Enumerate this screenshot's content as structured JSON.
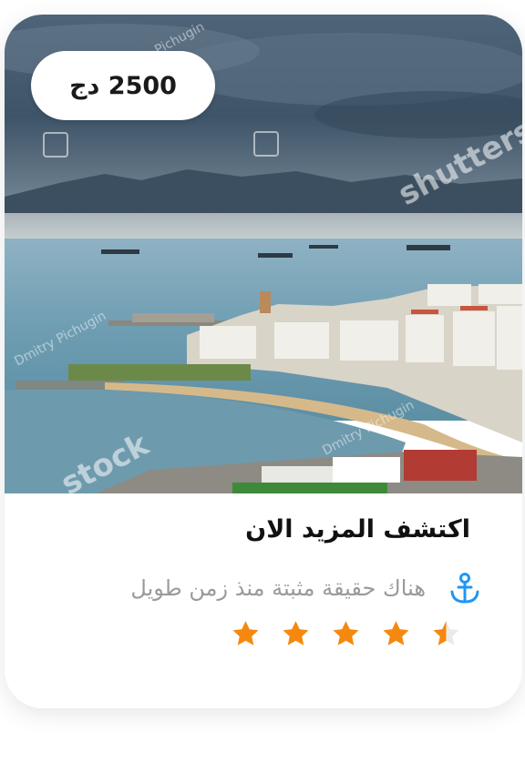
{
  "card": {
    "price": "2500 دج",
    "title": "اكتشف المزيد الان",
    "subtitle": "هناك حقيقة مثبتة منذ زمن طويل",
    "location_icon": "anchor-icon",
    "rating": 4.5,
    "rating_max": 5,
    "image_watermarks": [
      "shutterstock",
      "Dmitry Pichugin"
    ]
  },
  "colors": {
    "star_filled": "#f5890f",
    "star_empty": "#eaeaea",
    "anchor": "#2196f3",
    "title": "#111111",
    "subtitle": "#9a9a9a"
  }
}
